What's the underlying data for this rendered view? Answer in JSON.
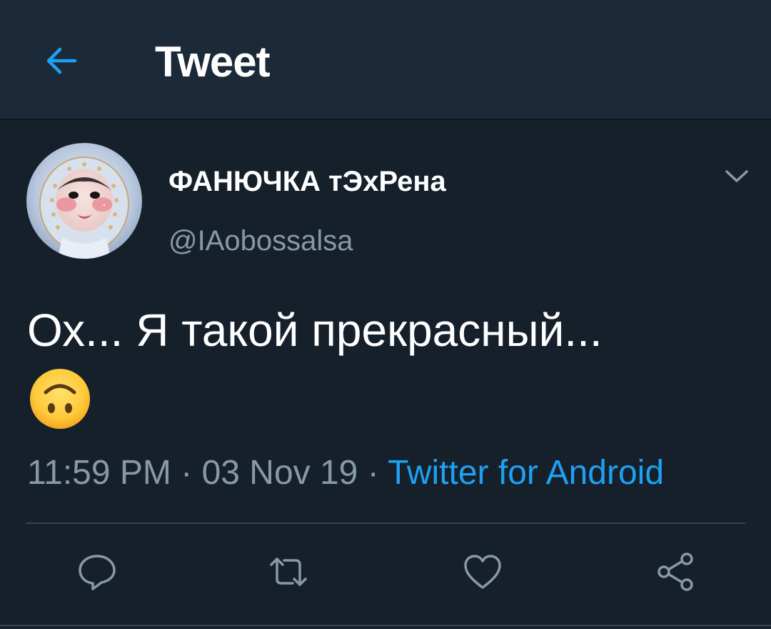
{
  "colors": {
    "background": "#15202b",
    "header": "#1c2938",
    "accent": "#1da1f2",
    "secondary_text": "#8899a6",
    "divider": "#38444d"
  },
  "header": {
    "back_icon": "arrow-left-icon",
    "title": "Tweet"
  },
  "tweet": {
    "author": {
      "display_name": "ФАНЮЧКА тЭхРена",
      "handle": "@IAobossalsa"
    },
    "menu_icon": "chevron-down-icon",
    "text": "Ох... Я такой прекрасный...",
    "emoji": "upside-down-face",
    "time": "11:59 PM",
    "date": "03 Nov 19",
    "separator": "·",
    "source": "Twitter for Android"
  },
  "actions": [
    {
      "name": "reply",
      "icon": "reply-icon"
    },
    {
      "name": "retweet",
      "icon": "retweet-icon"
    },
    {
      "name": "like",
      "icon": "heart-icon"
    },
    {
      "name": "share",
      "icon": "share-icon"
    }
  ]
}
